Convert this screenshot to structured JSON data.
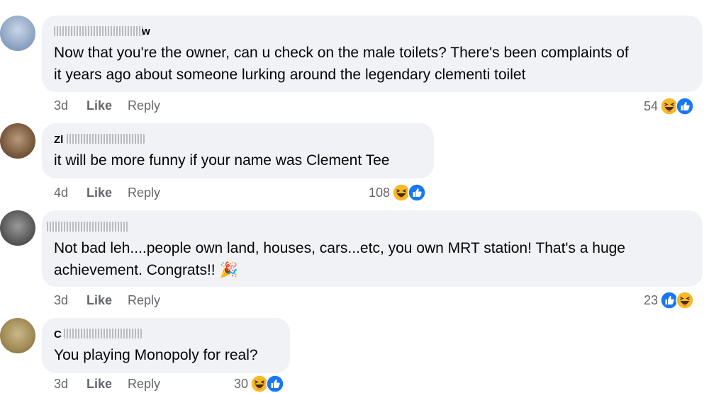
{
  "comments": [
    {
      "author": "w",
      "text_lines": [
        "Now that you're the owner, can u check on the male toilets? There's been complaints of",
        "it years ago about someone lurking around the legendary clementi toilet"
      ],
      "time": "3d",
      "like": "Like",
      "reply": "Reply",
      "reaction_count": "54",
      "reactions": [
        "haha-icon",
        "like-icon"
      ]
    },
    {
      "author": "Zl",
      "text_lines": [
        "it will be more funny if your name was Clement Tee"
      ],
      "time": "4d",
      "like": "Like",
      "reply": "Reply",
      "reaction_count": "108",
      "reactions": [
        "haha-icon",
        "like-icon"
      ]
    },
    {
      "author": "",
      "text_lines": [
        "Not bad leh....people own land, houses, cars...etc, you own MRT station! That's a huge",
        "achievement. Congrats!! 🎉"
      ],
      "time": "3d",
      "like": "Like",
      "reply": "Reply",
      "reaction_count": "23",
      "reactions": [
        "like-icon",
        "haha-icon"
      ]
    },
    {
      "author": "C",
      "text_lines": [
        "You playing Monopoly for real?"
      ],
      "time": "3d",
      "like": "Like",
      "reply": "Reply",
      "reaction_count": "30",
      "reactions": [
        "haha-icon",
        "like-icon"
      ]
    }
  ],
  "colors": {
    "bubble": "#f0f2f5",
    "secondary_text": "#65676b",
    "like_blue": "#1877f2",
    "haha_yellow": "#f7b928"
  }
}
